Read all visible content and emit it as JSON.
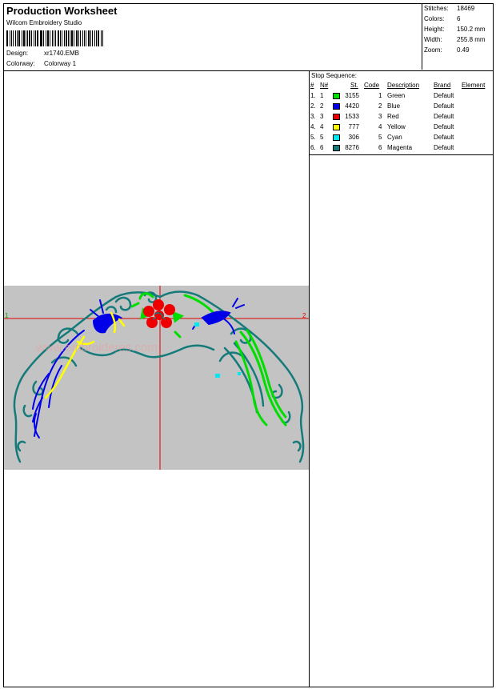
{
  "header": {
    "title": "Production Worksheet",
    "software": "Wilcom Embroidery Studio",
    "design_label": "Design:",
    "design_value": "xr1740.EMB",
    "colorway_label": "Colorway:",
    "colorway_value": "Colorway 1"
  },
  "stats": {
    "stitches_label": "Stitches:",
    "stitches_value": "18469",
    "colors_label": "Colors:",
    "colors_value": "6",
    "height_label": "Height:",
    "height_value": "150.2 mm",
    "width_label": "Width:",
    "width_value": "255.8 mm",
    "zoom_label": "Zoom:",
    "zoom_value": "0.49"
  },
  "canvas": {
    "marker_left": "1",
    "marker_right": "2",
    "watermark": "www.embroideres.com"
  },
  "stop_sequence": {
    "title": "Stop Sequence:",
    "headers": [
      "#",
      "N#",
      "St.",
      "Code",
      "Description",
      "Brand",
      "Element"
    ],
    "rows": [
      {
        "num": "1.",
        "n": "1",
        "color": "#00e000",
        "st": "3155",
        "code": "1",
        "desc": "Green",
        "brand": "Default"
      },
      {
        "num": "2.",
        "n": "2",
        "color": "#0000e8",
        "st": "4420",
        "code": "2",
        "desc": "Blue",
        "brand": "Default"
      },
      {
        "num": "3.",
        "n": "3",
        "color": "#ee0000",
        "st": "1533",
        "code": "3",
        "desc": "Red",
        "brand": "Default"
      },
      {
        "num": "4.",
        "n": "4",
        "color": "#ffff00",
        "st": "777",
        "code": "4",
        "desc": "Yellow",
        "brand": "Default"
      },
      {
        "num": "5.",
        "n": "5",
        "color": "#00e8f0",
        "st": "306",
        "code": "5",
        "desc": "Cyan",
        "brand": "Default"
      },
      {
        "num": "6.",
        "n": "6",
        "color": "#157a7a",
        "st": "8276",
        "code": "6",
        "desc": "Magenta",
        "brand": "Default"
      }
    ]
  }
}
